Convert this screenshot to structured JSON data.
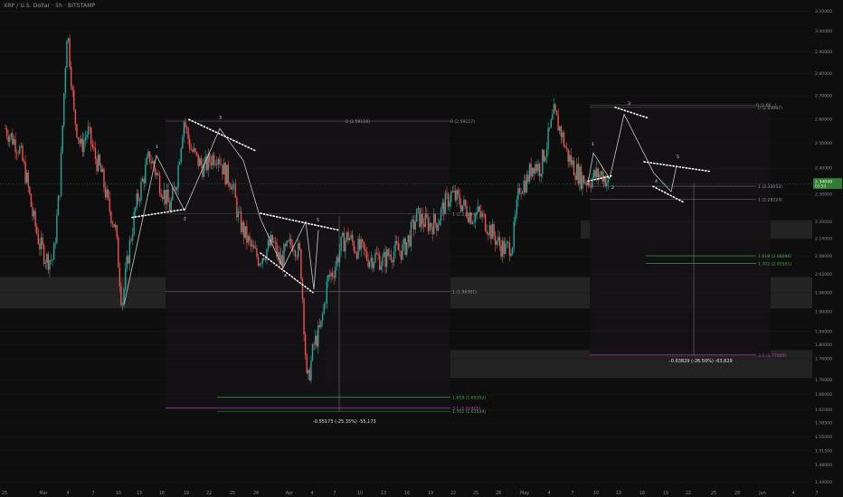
{
  "header": {
    "title": "XRP / U.S. Dollar · 5h · BITSTAMP"
  },
  "colors": {
    "background": "#0e0e0e",
    "up": "#26a69a",
    "down": "#ef5350",
    "pattern": "#c8c8c8",
    "price_label_bg": "#2e7d32",
    "fib_ext": "#c040c0",
    "fib_green": "#4caf50",
    "zone": "#2a2a2a"
  },
  "chart_data": {
    "type": "candlestick",
    "y_axis": {
      "scale": "log",
      "ticks": [
        "3.10000",
        "3.00000",
        "2.90000",
        "2.80000",
        "2.70000",
        "2.60000",
        "2.50000",
        "2.40000",
        "2.30000",
        "2.20000",
        "2.14000",
        "2.08000",
        "2.02000",
        "1.96000",
        "1.90000",
        "1.84000",
        "1.80000",
        "1.76000",
        "1.70000",
        "1.66000",
        "1.62000",
        "1.58500",
        "1.55000",
        "1.51500",
        "1.48000",
        "1.44000"
      ],
      "range": [
        1.43,
        3.11
      ]
    },
    "x_axis": {
      "ticks": [
        "25",
        "Mar",
        "4",
        "7",
        "10",
        "13",
        "16",
        "19",
        "22",
        "25",
        "28",
        "Apr",
        "4",
        "7",
        "10",
        "13",
        "16",
        "19",
        "22",
        "25",
        "28",
        "May",
        "4",
        "7",
        "10",
        "13",
        "16",
        "19",
        "22",
        "25",
        "28",
        "Jun",
        "4",
        "7"
      ]
    },
    "last_price": {
      "value": "2.34049",
      "countdown": "03:53"
    },
    "price_path": [
      [
        "Feb 22",
        2.56
      ],
      [
        "Feb 24",
        2.48
      ],
      [
        "Feb 25",
        2.37
      ],
      [
        "Feb 26",
        2.22
      ],
      [
        "Feb 27",
        2.12
      ],
      [
        "Feb 28",
        2.07
      ],
      [
        "Mar 1",
        2.07
      ],
      [
        "Mar 2",
        2.35
      ],
      [
        "Mar 3",
        3.02
      ],
      [
        "Mar 4",
        2.62
      ],
      [
        "Mar 5",
        2.48
      ],
      [
        "Mar 6",
        2.55
      ],
      [
        "Mar 7",
        2.45
      ],
      [
        "Mar 8",
        2.38
      ],
      [
        "Mar 9",
        2.26
      ],
      [
        "Mar 10",
        2.18
      ],
      [
        "Mar 11",
        1.92
      ],
      [
        "Mar 12",
        2.1
      ],
      [
        "Mar 13",
        2.25
      ],
      [
        "Mar 14",
        2.35
      ],
      [
        "Mar 15",
        2.45
      ],
      [
        "Mar 16",
        2.38
      ],
      [
        "Mar 17",
        2.31
      ],
      [
        "Mar 18",
        2.25
      ],
      [
        "Mar 19",
        2.36
      ],
      [
        "Mar 20",
        2.6
      ],
      [
        "Mar 21",
        2.48
      ],
      [
        "Mar 22",
        2.43
      ],
      [
        "Mar 23",
        2.4
      ],
      [
        "Mar 24",
        2.44
      ],
      [
        "Mar 25",
        2.46
      ],
      [
        "Mar 26",
        2.38
      ],
      [
        "Mar 27",
        2.35
      ],
      [
        "Mar 28",
        2.21
      ],
      [
        "Mar 29",
        2.15
      ],
      [
        "Mar 30",
        2.1
      ],
      [
        "Mar 31",
        2.07
      ],
      [
        "Apr 1",
        2.1
      ],
      [
        "Apr 2",
        2.13
      ],
      [
        "Apr 3",
        2.06
      ],
      [
        "Apr 4",
        2.1
      ],
      [
        "Apr 5",
        2.13
      ],
      [
        "Apr 6",
        2.08
      ],
      [
        "Apr 7",
        1.68
      ],
      [
        "Apr 8",
        1.8
      ],
      [
        "Apr 9",
        1.85
      ],
      [
        "Apr 10",
        2.0
      ],
      [
        "Apr 11",
        2.04
      ],
      [
        "Apr 12",
        2.12
      ],
      [
        "Apr 13",
        2.15
      ],
      [
        "Apr 14",
        2.11
      ],
      [
        "Apr 15",
        2.1
      ],
      [
        "Apr 16",
        2.07
      ],
      [
        "Apr 17",
        2.08
      ],
      [
        "Apr 18",
        2.06
      ],
      [
        "Apr 19",
        2.09
      ],
      [
        "Apr 20",
        2.1
      ],
      [
        "Apr 21",
        2.1
      ],
      [
        "Apr 22",
        2.15
      ],
      [
        "Apr 23",
        2.22
      ],
      [
        "Apr 24",
        2.2
      ],
      [
        "Apr 25",
        2.19
      ],
      [
        "Apr 26",
        2.2
      ],
      [
        "Apr 27",
        2.26
      ],
      [
        "Apr 28",
        2.3
      ],
      [
        "Apr 29",
        2.28
      ],
      [
        "Apr 30",
        2.25
      ],
      [
        "May 1",
        2.22
      ],
      [
        "May 2",
        2.23
      ],
      [
        "May 3",
        2.2
      ],
      [
        "May 4",
        2.16
      ],
      [
        "May 5",
        2.12
      ],
      [
        "May 6",
        2.1
      ],
      [
        "May 7",
        2.13
      ],
      [
        "May 8",
        2.33
      ],
      [
        "May 9",
        2.35
      ],
      [
        "May 10",
        2.42
      ],
      [
        "May 11",
        2.4
      ],
      [
        "May 12",
        2.5
      ],
      [
        "May 13",
        2.62
      ],
      [
        "May 14",
        2.55
      ],
      [
        "May 15",
        2.45
      ],
      [
        "May 16",
        2.4
      ],
      [
        "May 17",
        2.36
      ],
      [
        "May 18",
        2.35
      ],
      [
        "May 19",
        2.37
      ],
      [
        "May 20",
        2.38
      ],
      [
        "May 21",
        2.34
      ]
    ],
    "annotations": {
      "fib_labels": [
        "0 (2.59119)",
        "0 (2.59117)",
        "1 (2.22894)",
        "1 (1.96301)",
        "1.618 (1.65352)",
        "1.702 (1.61549)",
        "3.1 (1.62405)",
        "0 (2.66...)",
        "0 (2.64997)",
        "1 (2.33053)",
        "1 (2.28224)",
        "1.618 (2.08096)",
        "1.702 (2.05501)",
        "3.1 (1.77049)"
      ],
      "measure_labels": [
        "-0.55173 (-25.35%) -55,173",
        "-0.63829 (-26.50%) -63,829"
      ],
      "wave_labels": [
        "1",
        "2",
        "3",
        "4",
        "5",
        "1",
        "2",
        "3",
        "4",
        "5",
        "1",
        "2",
        "3",
        "4",
        "5"
      ]
    }
  }
}
